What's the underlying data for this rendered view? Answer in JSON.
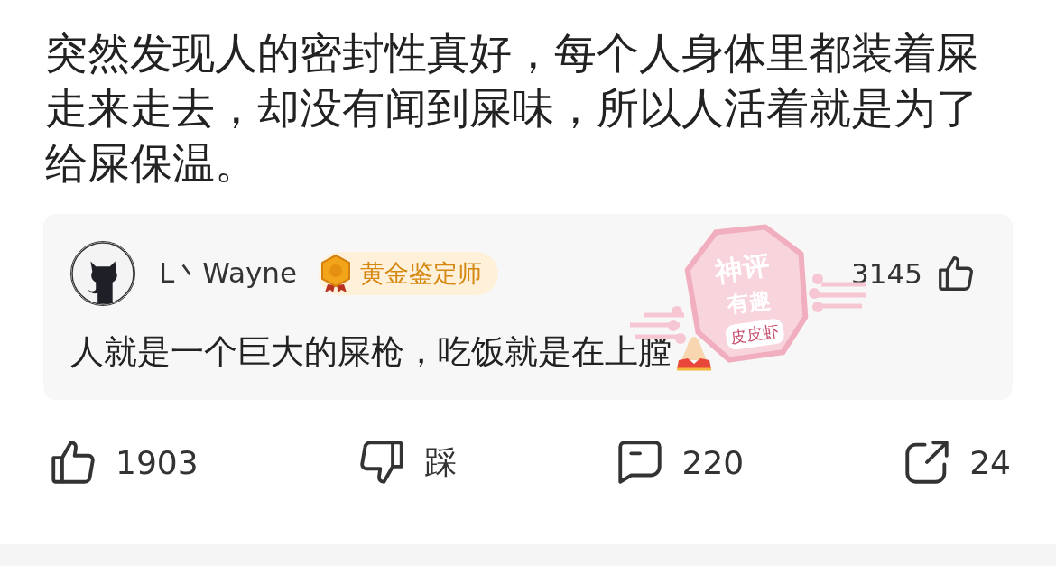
{
  "post": {
    "text": "突然发现人的密封性真好，每个人身体里都装着屎走来走去，却没有闻到屎味，所以人活着就是为了给屎保温。"
  },
  "top_comment": {
    "author": "L丶Wayne",
    "badge": "黄金鉴定师",
    "likes": "3145",
    "text": "人就是一个巨大的屎枪，吃饭就是在上膛",
    "stamp": {
      "title": "神评",
      "subtitle": "有趣",
      "brand": "皮皮虾"
    }
  },
  "actions": [
    {
      "kind": "like",
      "label": "1903"
    },
    {
      "kind": "dislike",
      "label": "踩"
    },
    {
      "kind": "comment",
      "label": "220"
    },
    {
      "kind": "share",
      "label": "24"
    }
  ]
}
